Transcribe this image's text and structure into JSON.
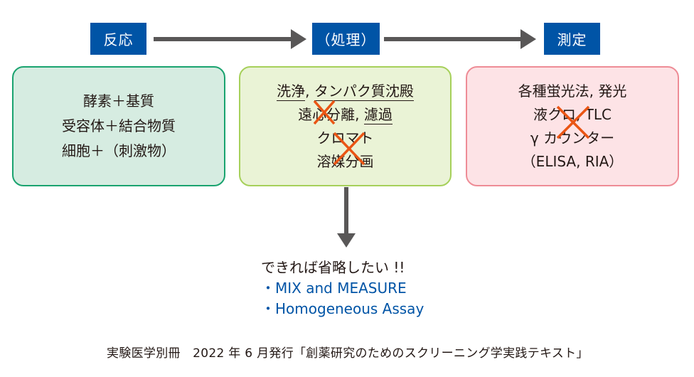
{
  "stages": [
    {
      "label": "反応"
    },
    {
      "label": "（処理）"
    },
    {
      "label": "測定"
    }
  ],
  "boxes": {
    "reaction": {
      "lines": [
        "酵素＋基質",
        "受容体＋結合物質",
        "細胞＋（刺激物）"
      ]
    },
    "processing": {
      "line1_a": "洗浄",
      "line1_sep": ", ",
      "line1_b": "タンパク質沈殿",
      "line2_a": "遠心分離",
      "line2_sep": ", ",
      "line2_b": "濾過",
      "line3": "クロマト",
      "line4": "溶媒分画"
    },
    "measurement": {
      "lines": [
        "各種蛍光法, 発光",
        "液クロ, TLC",
        "γ カウンター",
        "（ELISA, RIA）"
      ]
    }
  },
  "note": {
    "heading": "できれば省略したい !!",
    "bullets": [
      "・MIX and MEASURE",
      "・Homogeneous Assay"
    ]
  },
  "footer": "実験医学別冊　2022 年 6 月発行「創薬研究のためのスクリーニング学実践テキスト」",
  "colors": {
    "stage_bg": "#0054a6",
    "arrow": "#595757",
    "cross": "#ea5514",
    "note_blue": "#0054a6"
  }
}
